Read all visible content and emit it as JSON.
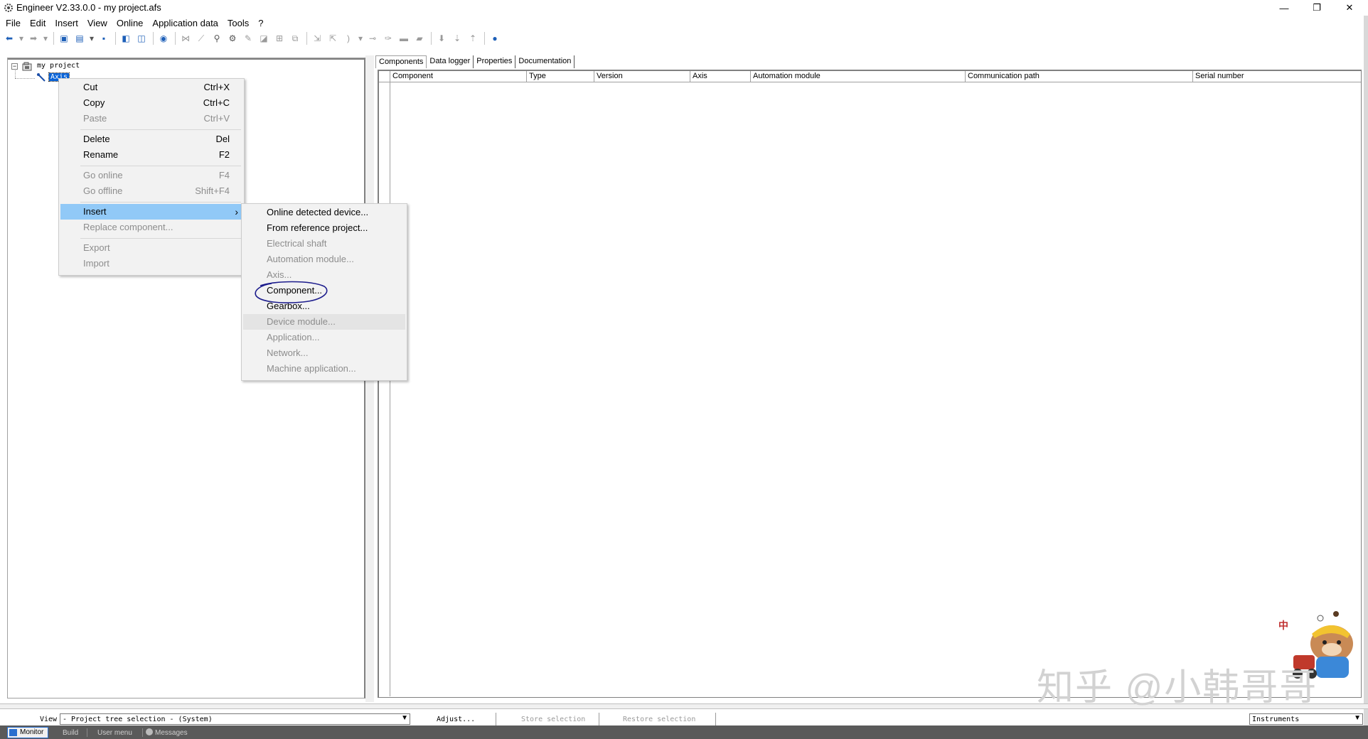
{
  "window": {
    "title": "Engineer V2.33.0.0 - my project.afs",
    "minimize_glyph": "—",
    "restore_glyph": "❐",
    "close_glyph": "✕"
  },
  "menubar": [
    "File",
    "Edit",
    "Insert",
    "View",
    "Online",
    "Application data",
    "Tools",
    "?"
  ],
  "tree": {
    "root_label": "my project",
    "child_label": "Axis"
  },
  "context_menu": {
    "items": [
      {
        "label": "Cut",
        "shortcut": "Ctrl+X",
        "enabled": true
      },
      {
        "label": "Copy",
        "shortcut": "Ctrl+C",
        "enabled": true
      },
      {
        "label": "Paste",
        "shortcut": "Ctrl+V",
        "enabled": false
      },
      {
        "label": "Delete",
        "shortcut": "Del",
        "enabled": true
      },
      {
        "label": "Rename",
        "shortcut": "F2",
        "enabled": true
      },
      {
        "label": "Go online",
        "shortcut": "F4",
        "enabled": false
      },
      {
        "label": "Go offline",
        "shortcut": "Shift+F4",
        "enabled": false
      },
      {
        "label": "Insert",
        "shortcut": "",
        "enabled": true
      },
      {
        "label": "Replace component...",
        "shortcut": "",
        "enabled": false
      },
      {
        "label": "Export",
        "shortcut": "",
        "enabled": false
      },
      {
        "label": "Import",
        "shortcut": "",
        "enabled": false
      }
    ],
    "submenu_arrow": "›"
  },
  "submenu": {
    "items": [
      {
        "label": "Online detected device...",
        "enabled": true
      },
      {
        "label": "From reference project...",
        "enabled": true
      },
      {
        "label": "Electrical shaft",
        "enabled": false
      },
      {
        "label": "Automation module...",
        "enabled": false
      },
      {
        "label": "Axis...",
        "enabled": false
      },
      {
        "label": "Component...",
        "enabled": true
      },
      {
        "label": "Gearbox...",
        "enabled": true
      },
      {
        "label": "Device module...",
        "enabled": false
      },
      {
        "label": "Application...",
        "enabled": false
      },
      {
        "label": "Network...",
        "enabled": false
      },
      {
        "label": "Machine application...",
        "enabled": false
      }
    ]
  },
  "tabs": [
    "Components",
    "Data logger",
    "Properties",
    "Documentation"
  ],
  "grid": {
    "columns": [
      "Component",
      "Type",
      "Version",
      "Axis",
      "Automation module",
      "Communication path",
      "Serial number"
    ]
  },
  "bottom": {
    "view_label": "View",
    "view_value": "- Project tree selection - (System)",
    "adjust_label": "Adjust...",
    "store_label": "Store selection",
    "restore_label": "Restore selection",
    "instruments_value": "Instruments"
  },
  "status_tabs": [
    "Monitor",
    "Build",
    "User menu",
    "Messages"
  ],
  "watermark": {
    "text": "知乎 @小韩哥哥",
    "ime_char": "中"
  },
  "colors": {
    "highlight": "#91c9f7",
    "annotation_circle": "#1c1c8c",
    "selection": "#0a64d8"
  }
}
